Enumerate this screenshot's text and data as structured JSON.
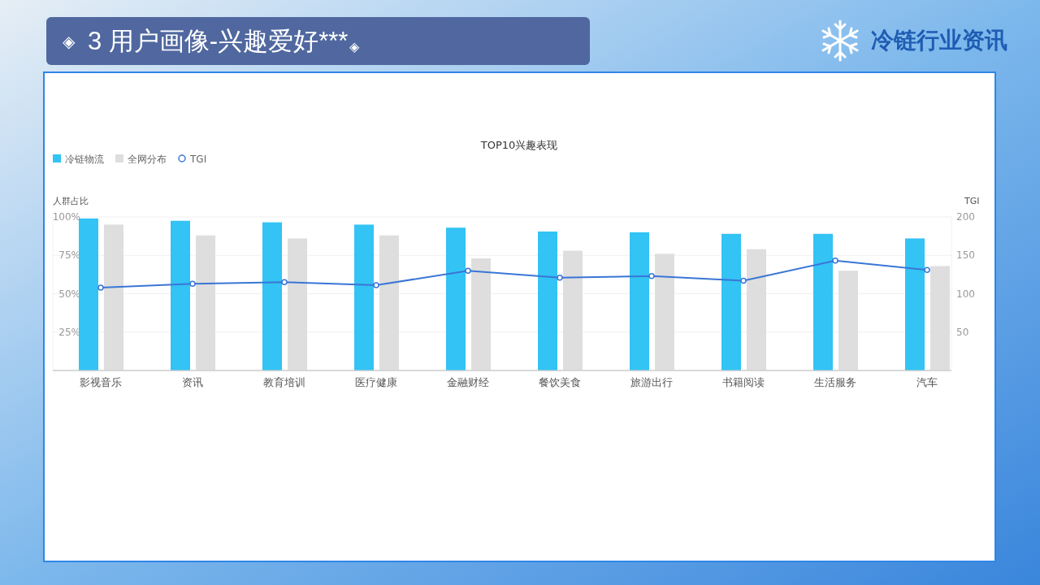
{
  "header": {
    "bullet": "◈",
    "title": "3 用户画像-兴趣爱好***",
    "end_mark": "◈"
  },
  "logo": {
    "text": "冷链行业资讯"
  },
  "chart": {
    "chart_data": {
      "type": "bar",
      "title": "TOP10兴趣表现",
      "ylabel": "人群占比",
      "stacked": false,
      "grid": true,
      "legend": "top-left",
      "categories": [
        "影视音乐",
        "资讯",
        "教育培训",
        "医疗健康",
        "金融财经",
        "餐饮美食",
        "旅游出行",
        "书籍阅读",
        "生活服务",
        "汽车"
      ],
      "series": [
        {
          "name": "冷链物流",
          "color": "#33c3f4",
          "values": [
            99,
            97.5,
            96.5,
            95,
            93,
            90.5,
            90,
            89,
            89,
            86
          ]
        },
        {
          "name": "全网分布",
          "color": "#dedede",
          "values": [
            95,
            88,
            86,
            88,
            73,
            78,
            76,
            79,
            65,
            68
          ]
        }
      ],
      "ylim": [
        0,
        100
      ],
      "yticks": [
        {
          "value": 25,
          "label": "25%"
        },
        {
          "value": 50,
          "label": "50%"
        },
        {
          "value": 75,
          "label": "75%"
        },
        {
          "value": 100,
          "label": "100%"
        }
      ]
    }
  },
  "tgi_chart": {
    "chart_data": {
      "type": "line",
      "ylabel": "TGI",
      "legend": "top-left",
      "series": [
        {
          "name": "TGI",
          "color": "#3a76d6",
          "marker": "circle",
          "values": [
            108,
            113,
            115,
            111,
            130,
            121,
            123,
            117,
            143,
            131
          ]
        }
      ],
      "ylim": [
        0,
        200
      ],
      "yticks": [
        50,
        100,
        150,
        200
      ]
    }
  }
}
